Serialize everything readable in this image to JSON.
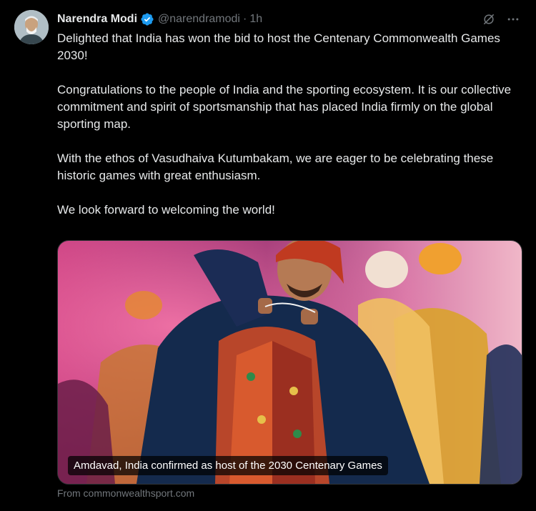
{
  "author": {
    "name": "Narendra Modi",
    "handle": "@narendramodi",
    "separator": "·",
    "time": "1h",
    "verified_color": "#1d9bf0"
  },
  "post": {
    "paragraphs": [
      "Delighted that India has won the bid to host the Centenary Commonwealth Games 2030!",
      "Congratulations to the people of India and the sporting ecosystem. It is our collective commitment and spirit of sportsmanship that has placed India firmly on the global sporting map.",
      "With the ethos of Vasudhaiva Kutumbakam, we are eager to be celebrating these historic games with great enthusiasm.",
      "We look forward to welcoming the world!"
    ]
  },
  "media": {
    "caption": "Amdavad, India confirmed as host of the 2030 Centenary Games"
  },
  "link_source": "From commonwealthsport.com",
  "icons": {
    "grok": "grok-icon",
    "more": "more-options-icon",
    "verified": "verified-badge-icon"
  },
  "colors": {
    "background": "#000000",
    "text": "#e7e9ea",
    "secondary": "#71767b"
  }
}
